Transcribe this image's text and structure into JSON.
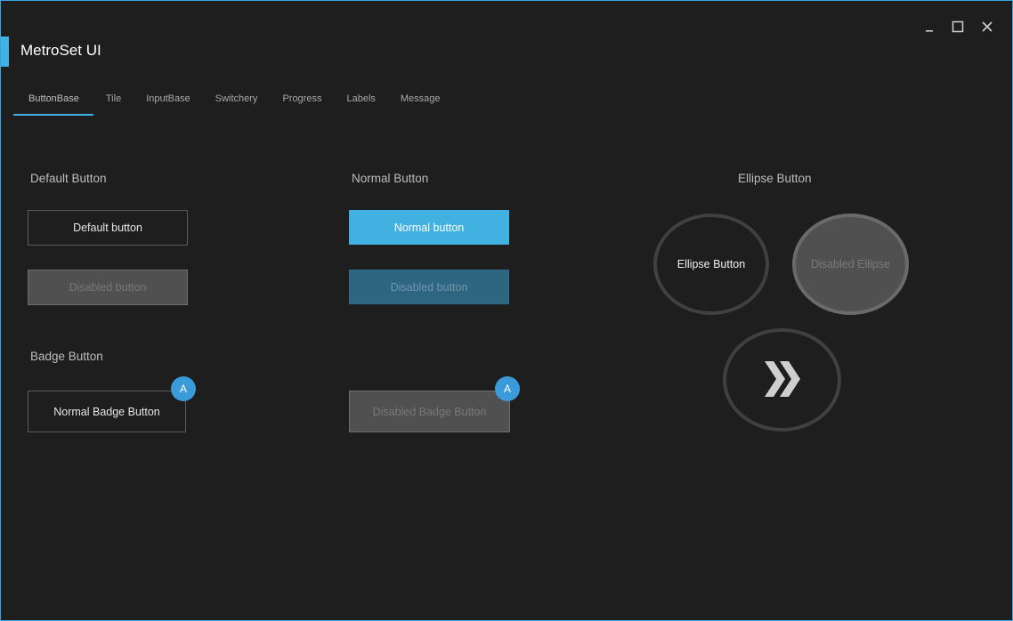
{
  "window": {
    "title": "MetroSet UI",
    "accent_color": "#41b1e1",
    "controls": [
      "minimize-icon",
      "maximize-icon",
      "close-icon"
    ]
  },
  "tabs": [
    {
      "label": "ButtonBase",
      "active": true
    },
    {
      "label": "Tile"
    },
    {
      "label": "InputBase"
    },
    {
      "label": "Switchery"
    },
    {
      "label": "Progress"
    },
    {
      "label": "Labels"
    },
    {
      "label": "Message"
    }
  ],
  "sections": {
    "default": {
      "title": "Default Button",
      "button_label": "Default button",
      "disabled_label": "Disabled button"
    },
    "normal": {
      "title": "Normal Button",
      "button_label": "Normal button",
      "disabled_label": "Disabled button"
    },
    "ellipse": {
      "title": "Ellipse Button",
      "button_label": "Ellipse Button",
      "disabled_label": "Disabled Ellipse",
      "icon_button": "double-chevron-right-icon"
    },
    "badge": {
      "title": "Badge Button",
      "normal_label": "Normal Badge Button",
      "normal_badge": "A",
      "disabled_label": "Disabled Badge Button",
      "disabled_badge": "A"
    }
  }
}
